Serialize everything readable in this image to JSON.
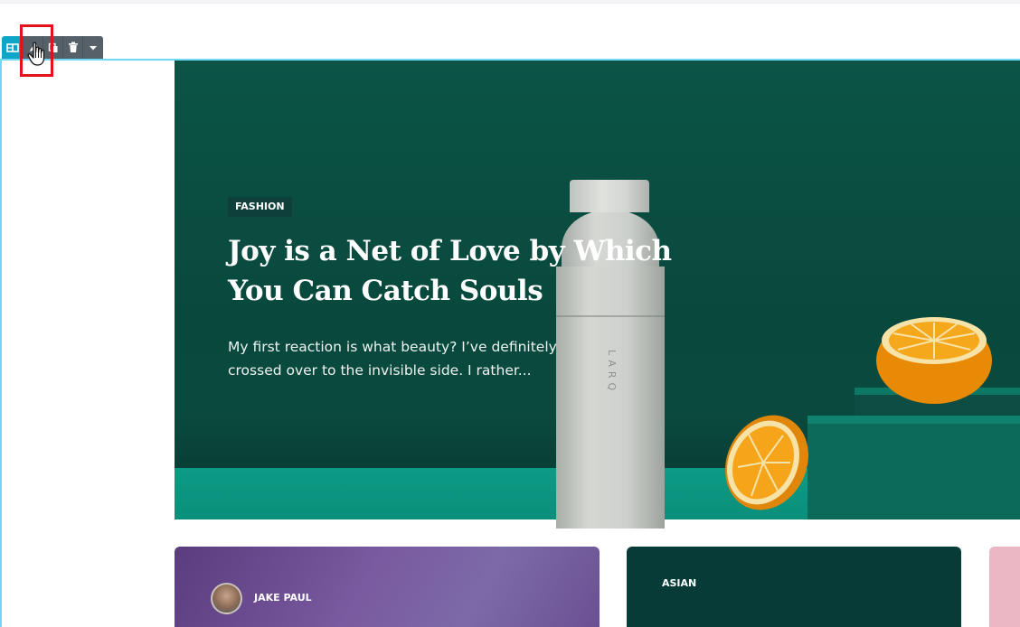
{
  "toolbar": {
    "buttons": [
      "section-handle",
      "edit",
      "duplicate",
      "delete",
      "more"
    ]
  },
  "hero": {
    "category": "FASHION",
    "title": "Joy is a Net of Love by Which You Can Catch Souls",
    "excerpt": "My first reaction is what beauty? I’ve definitely crossed over to the invisible side. I rather...",
    "bottle_brand": "LARQ"
  },
  "cards": [
    {
      "author": "JAKE PAUL"
    },
    {
      "category": "ASIAN"
    }
  ],
  "colors": {
    "accent": "#71d7f7",
    "toolbar": "#556068",
    "highlight": "#e3121b",
    "hero_bg": "#0b5446"
  }
}
